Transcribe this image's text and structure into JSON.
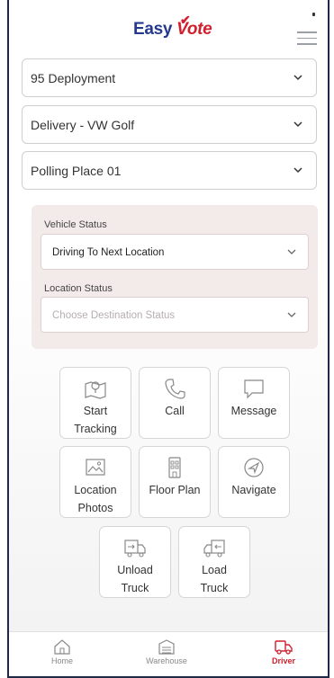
{
  "header": {
    "logo_part1": "Easy",
    "logo_part2": "Vote",
    "menu_icon": "hamburger-menu-icon"
  },
  "selects": [
    {
      "value": "95 Deployment"
    },
    {
      "value": "Delivery - VW Golf"
    },
    {
      "value": "Polling Place 01"
    }
  ],
  "status_panel": {
    "vehicle_label": "Vehicle Status",
    "vehicle_value": "Driving To Next Location",
    "location_label": "Location Status",
    "location_placeholder": "Choose Destination Status"
  },
  "actions": [
    {
      "label_line1": "Start",
      "label_line2": "Tracking",
      "icon": "map-pin-icon"
    },
    {
      "label_line1": "Call",
      "label_line2": "",
      "icon": "phone-icon"
    },
    {
      "label_line1": "Message",
      "label_line2": "",
      "icon": "chat-bubble-icon"
    },
    {
      "label_line1": "Location",
      "label_line2": "Photos",
      "icon": "image-icon"
    },
    {
      "label_line1": "Floor Plan",
      "label_line2": "",
      "icon": "floor-plan-icon"
    },
    {
      "label_line1": "Navigate",
      "label_line2": "",
      "icon": "navigation-arrow-icon"
    },
    {
      "label_line1": "Unload",
      "label_line2": "Truck",
      "icon": "truck-unload-icon"
    },
    {
      "label_line1": "Load",
      "label_line2": "Truck",
      "icon": "truck-load-icon"
    }
  ],
  "bottom_nav": [
    {
      "label": "Home",
      "icon": "home-icon",
      "active": false
    },
    {
      "label": "Warehouse",
      "icon": "warehouse-icon",
      "active": false
    },
    {
      "label": "Driver",
      "icon": "truck-icon",
      "active": true
    }
  ],
  "colors": {
    "brand_blue": "#253a8e",
    "brand_red": "#d0202e",
    "panel_bg": "#f3ebea"
  }
}
